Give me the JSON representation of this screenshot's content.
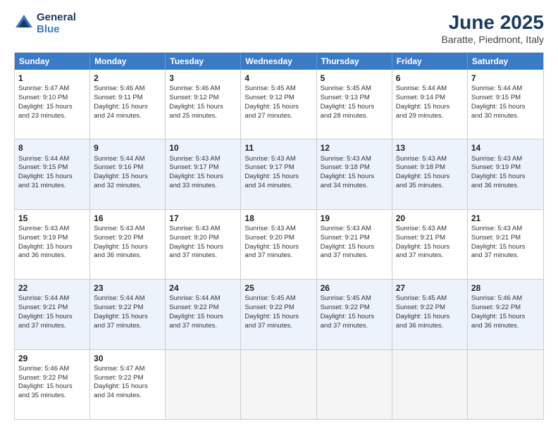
{
  "header": {
    "logo_line1": "General",
    "logo_line2": "Blue",
    "main_title": "June 2025",
    "subtitle": "Baratte, Piedmont, Italy"
  },
  "days_of_week": [
    "Sunday",
    "Monday",
    "Tuesday",
    "Wednesday",
    "Thursday",
    "Friday",
    "Saturday"
  ],
  "weeks": [
    [
      {
        "day": "1",
        "info": "Sunrise: 5:47 AM\nSunset: 9:10 PM\nDaylight: 15 hours\nand 23 minutes."
      },
      {
        "day": "2",
        "info": "Sunrise: 5:46 AM\nSunset: 9:11 PM\nDaylight: 15 hours\nand 24 minutes."
      },
      {
        "day": "3",
        "info": "Sunrise: 5:46 AM\nSunset: 9:12 PM\nDaylight: 15 hours\nand 25 minutes."
      },
      {
        "day": "4",
        "info": "Sunrise: 5:45 AM\nSunset: 9:12 PM\nDaylight: 15 hours\nand 27 minutes."
      },
      {
        "day": "5",
        "info": "Sunrise: 5:45 AM\nSunset: 9:13 PM\nDaylight: 15 hours\nand 28 minutes."
      },
      {
        "day": "6",
        "info": "Sunrise: 5:44 AM\nSunset: 9:14 PM\nDaylight: 15 hours\nand 29 minutes."
      },
      {
        "day": "7",
        "info": "Sunrise: 5:44 AM\nSunset: 9:15 PM\nDaylight: 15 hours\nand 30 minutes."
      }
    ],
    [
      {
        "day": "8",
        "info": "Sunrise: 5:44 AM\nSunset: 9:15 PM\nDaylight: 15 hours\nand 31 minutes."
      },
      {
        "day": "9",
        "info": "Sunrise: 5:44 AM\nSunset: 9:16 PM\nDaylight: 15 hours\nand 32 minutes."
      },
      {
        "day": "10",
        "info": "Sunrise: 5:43 AM\nSunset: 9:17 PM\nDaylight: 15 hours\nand 33 minutes."
      },
      {
        "day": "11",
        "info": "Sunrise: 5:43 AM\nSunset: 9:17 PM\nDaylight: 15 hours\nand 34 minutes."
      },
      {
        "day": "12",
        "info": "Sunrise: 5:43 AM\nSunset: 9:18 PM\nDaylight: 15 hours\nand 34 minutes."
      },
      {
        "day": "13",
        "info": "Sunrise: 5:43 AM\nSunset: 9:18 PM\nDaylight: 15 hours\nand 35 minutes."
      },
      {
        "day": "14",
        "info": "Sunrise: 5:43 AM\nSunset: 9:19 PM\nDaylight: 15 hours\nand 36 minutes."
      }
    ],
    [
      {
        "day": "15",
        "info": "Sunrise: 5:43 AM\nSunset: 9:19 PM\nDaylight: 15 hours\nand 36 minutes."
      },
      {
        "day": "16",
        "info": "Sunrise: 5:43 AM\nSunset: 9:20 PM\nDaylight: 15 hours\nand 36 minutes."
      },
      {
        "day": "17",
        "info": "Sunrise: 5:43 AM\nSunset: 9:20 PM\nDaylight: 15 hours\nand 37 minutes."
      },
      {
        "day": "18",
        "info": "Sunrise: 5:43 AM\nSunset: 9:20 PM\nDaylight: 15 hours\nand 37 minutes."
      },
      {
        "day": "19",
        "info": "Sunrise: 5:43 AM\nSunset: 9:21 PM\nDaylight: 15 hours\nand 37 minutes."
      },
      {
        "day": "20",
        "info": "Sunrise: 5:43 AM\nSunset: 9:21 PM\nDaylight: 15 hours\nand 37 minutes."
      },
      {
        "day": "21",
        "info": "Sunrise: 5:43 AM\nSunset: 9:21 PM\nDaylight: 15 hours\nand 37 minutes."
      }
    ],
    [
      {
        "day": "22",
        "info": "Sunrise: 5:44 AM\nSunset: 9:21 PM\nDaylight: 15 hours\nand 37 minutes."
      },
      {
        "day": "23",
        "info": "Sunrise: 5:44 AM\nSunset: 9:22 PM\nDaylight: 15 hours\nand 37 minutes."
      },
      {
        "day": "24",
        "info": "Sunrise: 5:44 AM\nSunset: 9:22 PM\nDaylight: 15 hours\nand 37 minutes."
      },
      {
        "day": "25",
        "info": "Sunrise: 5:45 AM\nSunset: 9:22 PM\nDaylight: 15 hours\nand 37 minutes."
      },
      {
        "day": "26",
        "info": "Sunrise: 5:45 AM\nSunset: 9:22 PM\nDaylight: 15 hours\nand 37 minutes."
      },
      {
        "day": "27",
        "info": "Sunrise: 5:45 AM\nSunset: 9:22 PM\nDaylight: 15 hours\nand 36 minutes."
      },
      {
        "day": "28",
        "info": "Sunrise: 5:46 AM\nSunset: 9:22 PM\nDaylight: 15 hours\nand 36 minutes."
      }
    ],
    [
      {
        "day": "29",
        "info": "Sunrise: 5:46 AM\nSunset: 9:22 PM\nDaylight: 15 hours\nand 35 minutes."
      },
      {
        "day": "30",
        "info": "Sunrise: 5:47 AM\nSunset: 9:22 PM\nDaylight: 15 hours\nand 34 minutes."
      },
      {
        "day": "",
        "info": ""
      },
      {
        "day": "",
        "info": ""
      },
      {
        "day": "",
        "info": ""
      },
      {
        "day": "",
        "info": ""
      },
      {
        "day": "",
        "info": ""
      }
    ]
  ]
}
